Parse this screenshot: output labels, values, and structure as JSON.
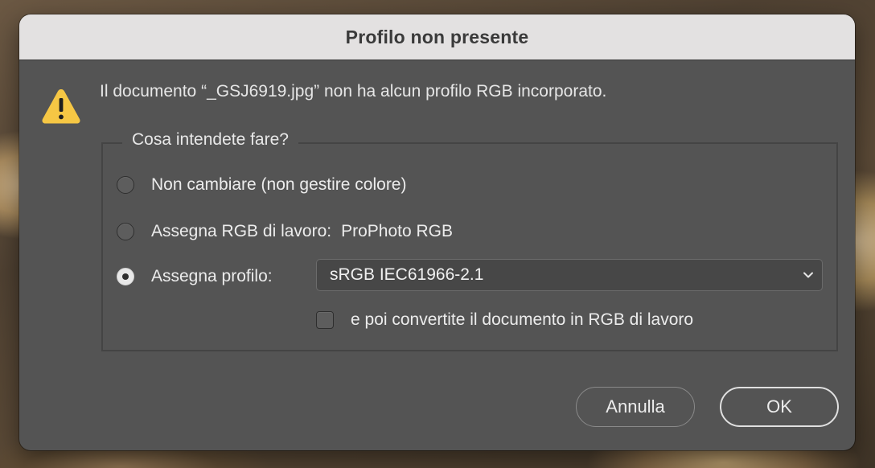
{
  "dialog": {
    "title": "Profilo non presente",
    "warning_icon": "warning-triangle-icon",
    "message": "Il documento “_GSJ6919.jpg” non ha alcun profilo RGB incorporato."
  },
  "options_group": {
    "legend": "Cosa intendete fare?",
    "options": [
      {
        "label": "Non cambiare (non gestire colore)",
        "checked": false
      },
      {
        "label": "Assegna RGB di lavoro:",
        "value": "ProPhoto RGB",
        "checked": false
      },
      {
        "label": "Assegna profilo:",
        "checked": true
      }
    ],
    "profile_select": {
      "selected": "sRGB IEC61966-2.1",
      "icon": "chevron-down-icon"
    },
    "convert_checkbox": {
      "label": "e poi convertite il documento in RGB di lavoro",
      "checked": false
    }
  },
  "buttons": {
    "cancel_label": "Annulla",
    "ok_label": "OK"
  },
  "colors": {
    "dialog_bg": "#545454",
    "titlebar_bg": "#e3e1e1",
    "warning_yellow": "#f6c744"
  }
}
